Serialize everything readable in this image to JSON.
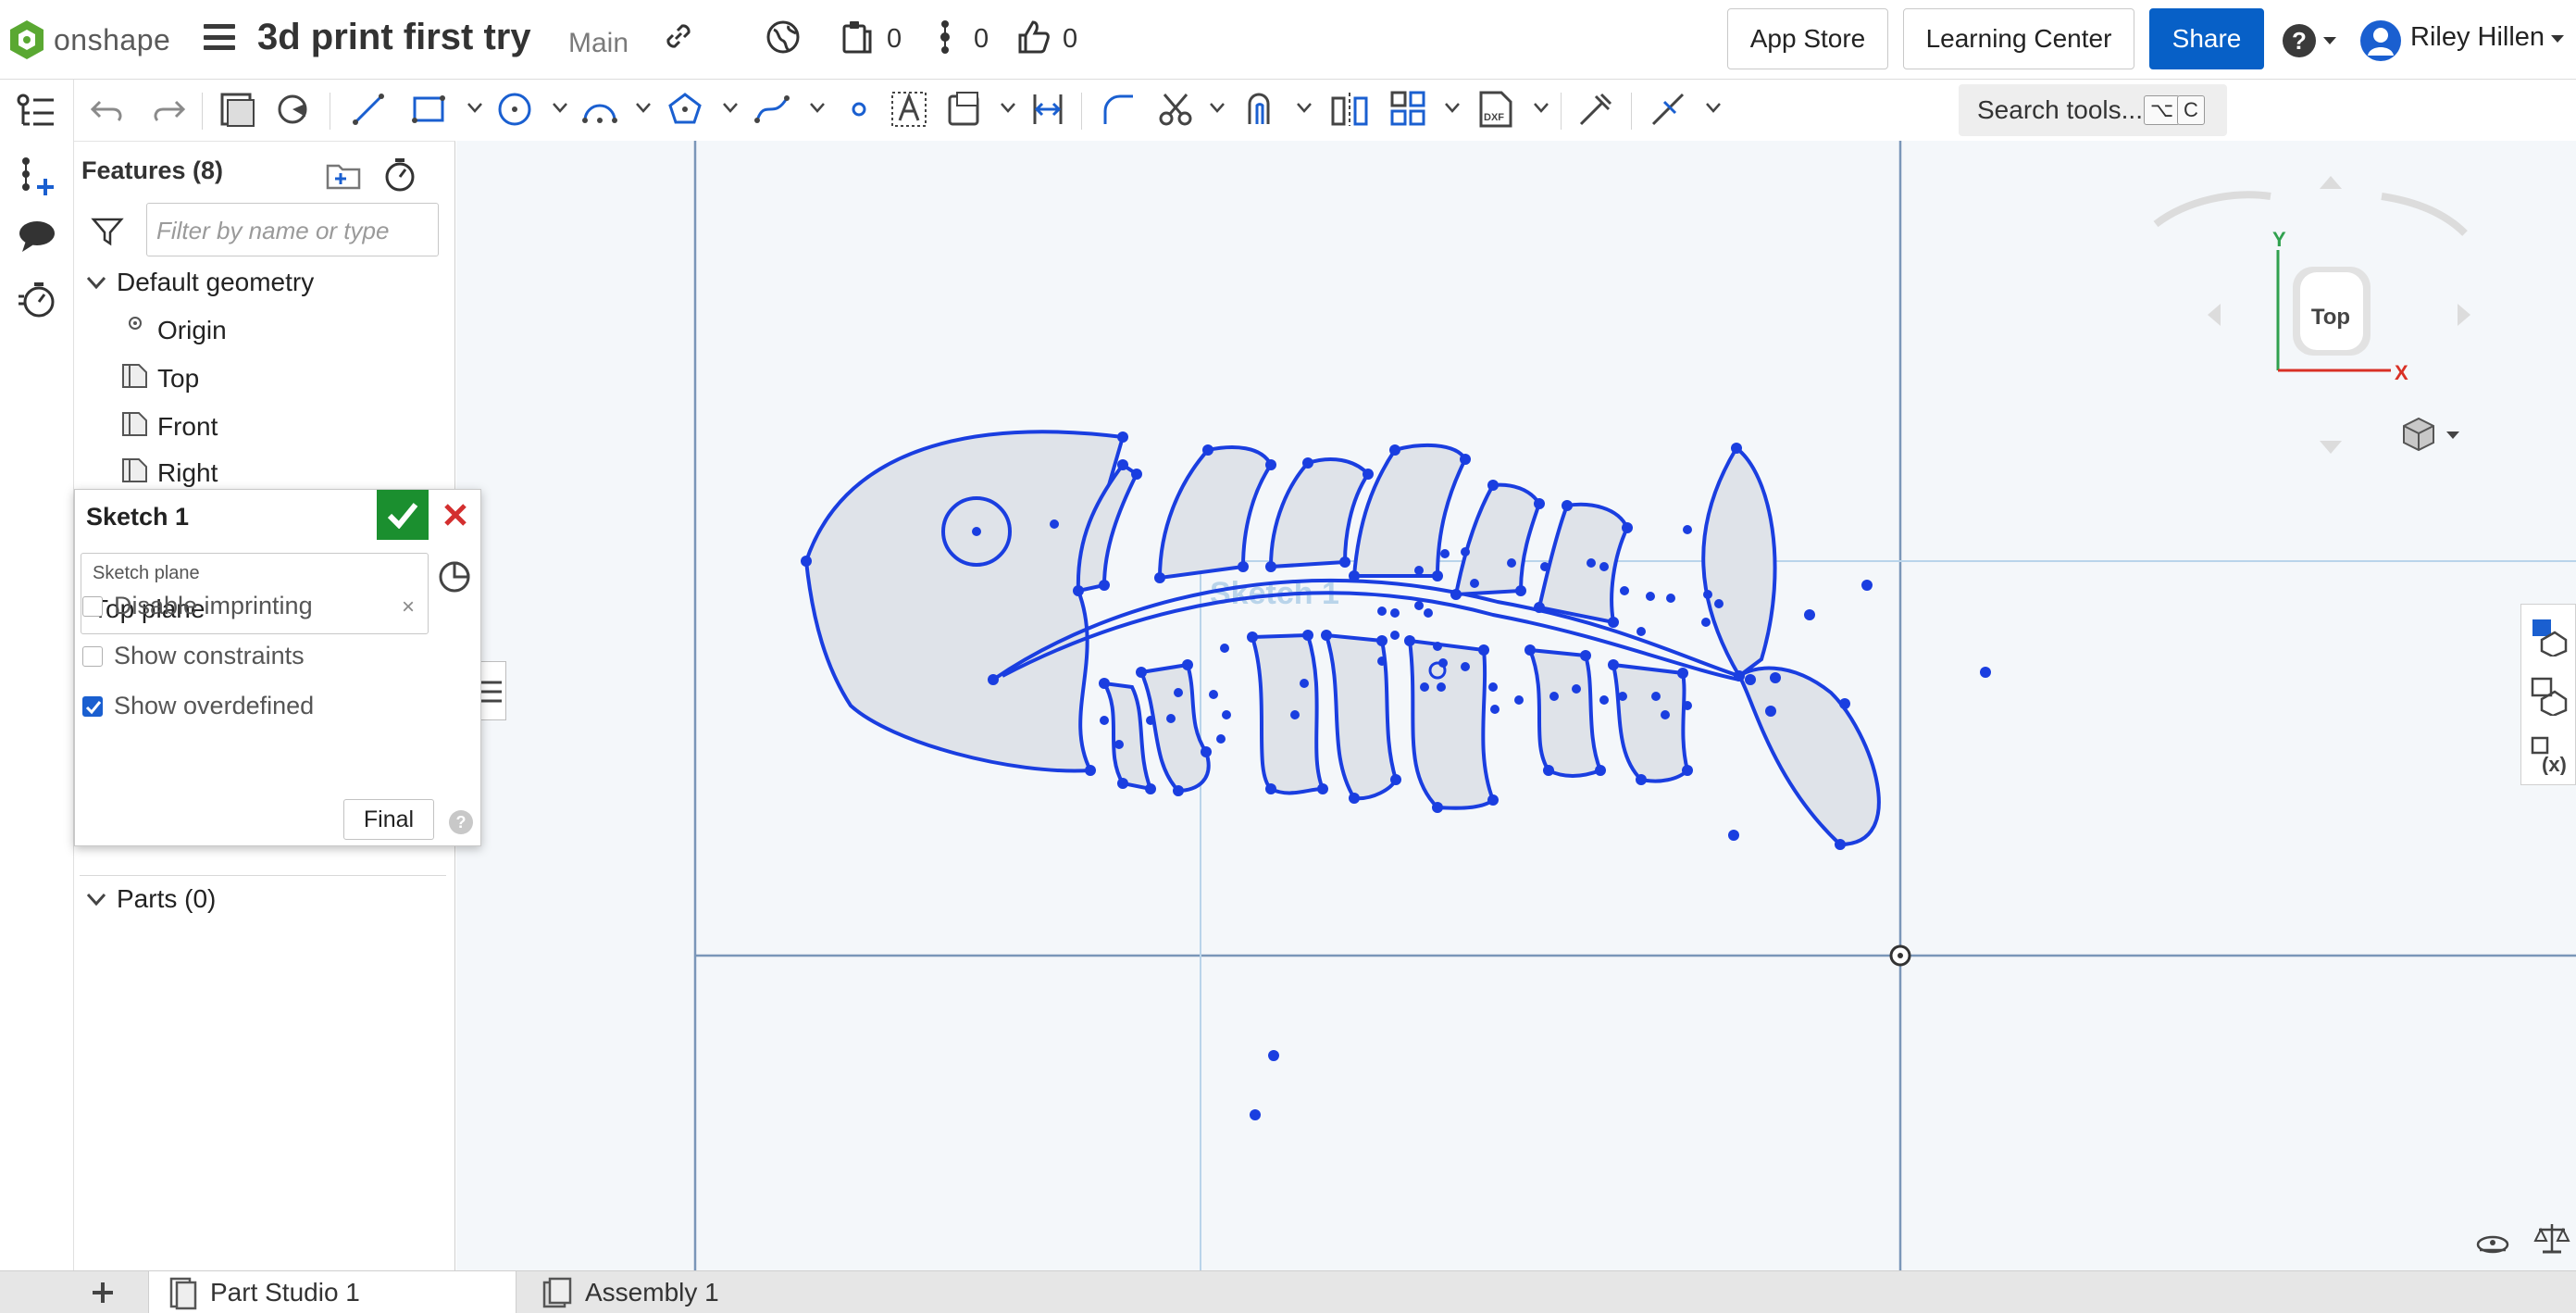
{
  "app": {
    "brand": "onshape",
    "document_title": "3d print first try",
    "branch": "Main"
  },
  "header": {
    "versions_count": "0",
    "comments_count": "0",
    "likes_count": "0",
    "app_store_label": "App Store",
    "learning_center_label": "Learning Center",
    "share_label": "Share",
    "help_label": "?",
    "user_name": "Riley Hillen"
  },
  "toolbar": {
    "search_label": "Search tools...",
    "search_shortcut_1": "⌥",
    "search_shortcut_2": "C"
  },
  "features": {
    "header": "Features (8)",
    "filter_placeholder": "Filter by name or type",
    "default_geometry_label": "Default geometry",
    "items": [
      {
        "label": "Origin"
      },
      {
        "label": "Top"
      },
      {
        "label": "Front"
      },
      {
        "label": "Right"
      }
    ],
    "parts_label": "Parts (0)"
  },
  "sketch_dialog": {
    "title": "Sketch 1",
    "plane_label": "Sketch plane",
    "plane_value": "Top plane",
    "options": [
      {
        "label": "Disable imprinting",
        "checked": false
      },
      {
        "label": "Show constraints",
        "checked": false
      },
      {
        "label": "Show overdefined",
        "checked": true
      }
    ],
    "final_label": "Final",
    "help_label": "?"
  },
  "canvas": {
    "sketch_label": "Sketch 1",
    "view_cube_label": "Top",
    "axis_x_label": "X",
    "axis_y_label": "Y",
    "sketch_color": "#1a3ee0",
    "fill_color": "#dfe3e9"
  },
  "tabs": [
    {
      "label": "Part Studio 1",
      "active": true
    },
    {
      "label": "Assembly 1",
      "active": false
    }
  ],
  "colors": {
    "accent": "#0760c7",
    "accept": "#1b8f2f",
    "cancel": "#d32f2f"
  }
}
